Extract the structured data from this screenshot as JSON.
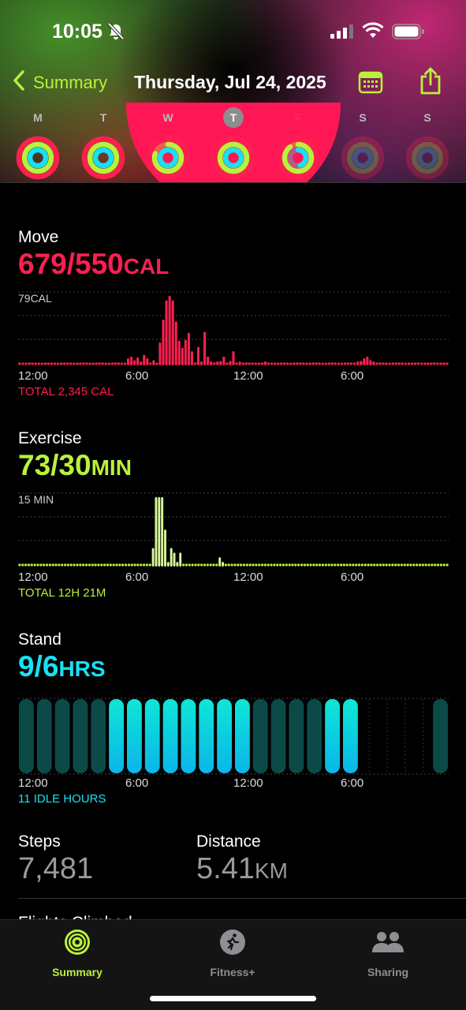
{
  "status": {
    "time": "10:05"
  },
  "nav": {
    "back_label": "Summary",
    "title": "Thursday, Jul 24, 2025"
  },
  "week": [
    {
      "letter": "M",
      "move": 1.0,
      "exercise": 1.0,
      "stand": 1.0,
      "dim": false
    },
    {
      "letter": "T",
      "move": 1.0,
      "exercise": 1.0,
      "stand": 1.0,
      "dim": false
    },
    {
      "letter": "W",
      "move": 0.55,
      "exercise": 0.8,
      "stand": 1.0,
      "dim": false
    },
    {
      "letter": "T",
      "move": 1.0,
      "exercise": 1.0,
      "stand": 1.0,
      "dim": false,
      "today": true
    },
    {
      "letter": "F",
      "move": 0.7,
      "exercise": 0.9,
      "stand": 0.45,
      "dim": false
    },
    {
      "letter": "S",
      "move": 0,
      "exercise": 0,
      "stand": 0,
      "dim": true
    },
    {
      "letter": "S",
      "move": 0,
      "exercise": 0,
      "stand": 0,
      "dim": true
    }
  ],
  "move": {
    "label": "Move",
    "value": "679/550",
    "unit": "CAL",
    "max_label": "79CAL",
    "axis": [
      "12:00",
      "6:00",
      "12:00",
      "6:00"
    ],
    "total": "TOTAL 2,345 CAL"
  },
  "exercise": {
    "label": "Exercise",
    "value": "73/30",
    "unit": "MIN",
    "max_label": "15 MIN",
    "axis": [
      "12:00",
      "6:00",
      "12:00",
      "6:00"
    ],
    "total": "TOTAL 12H 21M"
  },
  "stand": {
    "label": "Stand",
    "value": "9/6",
    "unit": "HRS",
    "axis": [
      "12:00",
      "6:00",
      "12:00",
      "6:00"
    ],
    "total": "11 IDLE HOURS"
  },
  "steps": {
    "label": "Steps",
    "value": "7,481"
  },
  "distance": {
    "label": "Distance",
    "value": "5.41",
    "unit": "KM"
  },
  "next_section": {
    "label": "Flights Climbed"
  },
  "tabs": [
    {
      "label": "Summary",
      "active": true
    },
    {
      "label": "Fitness+",
      "active": false
    },
    {
      "label": "Sharing",
      "active": false
    }
  ],
  "colors": {
    "move": "#ff1f4f",
    "exercise": "#b9f23a",
    "stand": "#17e1f4",
    "exercise_bar": "#d8f79a",
    "stand_active": "#0ee6d6",
    "stand_idle": "#0c4a48"
  },
  "chart_data": [
    {
      "type": "bar",
      "title": "Move",
      "ylabel": "CAL",
      "ylim": [
        0,
        79
      ],
      "values": [
        0,
        0,
        0,
        0,
        0,
        0,
        0,
        0,
        0,
        0,
        0,
        0,
        0,
        0,
        0,
        0,
        0,
        0,
        0,
        0,
        0,
        0,
        0,
        0,
        0,
        0,
        0,
        0,
        0,
        0,
        0,
        0,
        0,
        0,
        8,
        10,
        6,
        9,
        3,
        12,
        8,
        0,
        6,
        0,
        26,
        52,
        74,
        79,
        74,
        50,
        28,
        20,
        29,
        37,
        16,
        0,
        21,
        4,
        38,
        10,
        4,
        0,
        2,
        5,
        10,
        0,
        5,
        16,
        0,
        3,
        0,
        0,
        0,
        0,
        0,
        0,
        0,
        2,
        0,
        0,
        0,
        0,
        0,
        0,
        0,
        0,
        0,
        0,
        0,
        0,
        0,
        0,
        0,
        0,
        0,
        0,
        0,
        0,
        0,
        0,
        0,
        0,
        0,
        0,
        0,
        0,
        3,
        5,
        8,
        10,
        6,
        2,
        0,
        0,
        0,
        0,
        0,
        0,
        0,
        0,
        0,
        0,
        0,
        0,
        0,
        0,
        0,
        0,
        0,
        0,
        0,
        0,
        0,
        0,
        0
      ]
    },
    {
      "type": "bar",
      "title": "Exercise",
      "ylabel": "MIN",
      "ylim": [
        0,
        15
      ],
      "values": [
        0,
        0,
        0,
        0,
        0,
        0,
        0,
        0,
        0,
        0,
        0,
        0,
        0,
        0,
        0,
        0,
        0,
        0,
        0,
        0,
        0,
        0,
        0,
        0,
        0,
        0,
        0,
        0,
        0,
        0,
        0,
        0,
        0,
        0,
        0,
        0,
        0,
        0,
        0,
        0,
        0,
        0,
        0,
        0,
        4,
        15,
        15,
        15,
        8,
        1,
        4,
        3,
        1,
        3,
        0,
        0,
        0,
        0,
        0,
        0,
        0,
        0,
        0,
        0,
        0,
        0,
        2,
        1,
        0,
        0,
        0,
        0,
        0,
        0,
        0,
        0,
        0,
        0,
        0,
        0,
        0,
        0,
        0,
        0,
        0,
        0,
        0,
        0,
        0,
        0,
        0,
        0,
        0,
        0,
        0,
        0,
        0,
        0,
        0,
        0,
        0,
        0,
        0,
        0,
        0,
        0,
        0,
        0,
        0,
        0,
        0,
        0,
        0,
        0,
        0,
        0,
        0,
        0,
        0,
        0,
        0,
        0,
        0,
        0,
        0,
        0,
        0,
        0,
        0,
        0,
        0,
        0,
        0,
        0,
        0,
        0,
        0,
        0,
        0,
        0,
        0,
        0
      ]
    },
    {
      "type": "bar",
      "title": "Stand",
      "ylabel": "HRS",
      "categories": [
        "0",
        "1",
        "2",
        "3",
        "4",
        "5",
        "6",
        "7",
        "8",
        "9",
        "10",
        "11",
        "12",
        "13",
        "14",
        "15",
        "16",
        "17",
        "18",
        "19",
        "20",
        "21",
        "22",
        "23"
      ],
      "values": [
        0,
        0,
        0,
        0,
        0,
        1,
        1,
        1,
        1,
        1,
        1,
        1,
        1,
        0,
        0,
        0,
        0,
        1,
        1,
        0,
        0,
        0,
        0,
        0
      ],
      "recorded": [
        1,
        1,
        1,
        1,
        1,
        1,
        1,
        1,
        1,
        1,
        1,
        1,
        1,
        1,
        1,
        1,
        1,
        1,
        1,
        0,
        0,
        0,
        0,
        1,
        1
      ]
    }
  ]
}
